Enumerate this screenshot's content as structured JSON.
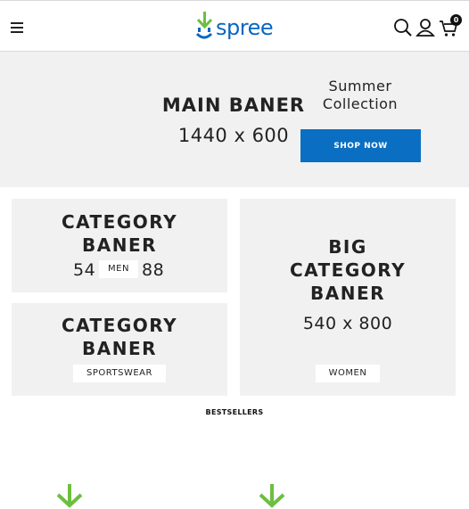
{
  "header": {
    "menu_icon": "hamburger-menu-icon",
    "logo_text": "spree",
    "icons": [
      "search-icon",
      "user-icon",
      "cart-icon"
    ],
    "cart_count": "0"
  },
  "hero": {
    "title": "MAIN BANER",
    "size": "1440 x 600",
    "collection_line1": "Summer",
    "collection_line2": "Collection",
    "cta_label": "SHOP NOW"
  },
  "categories": {
    "men": {
      "title_line1": "CATEGORY",
      "title_line2": "BANER",
      "size_left": "54",
      "tag": "MEN",
      "size_right": "88"
    },
    "sportswear": {
      "title_line1": "CATEGORY",
      "title_line2": "BANER",
      "tag": "SPORTSWEAR"
    },
    "women": {
      "title_line1": "BIG",
      "title_line2": "CATEGORY",
      "title_line3": "BANER",
      "size": "540 x 800",
      "tag": "WOMEN"
    }
  },
  "bestsellers": {
    "title": "BESTSELLERS"
  },
  "colors": {
    "brand_blue": "#0a6fc2",
    "logo_green": "#6cbf3f",
    "panel_gray": "#f1f1f1"
  }
}
